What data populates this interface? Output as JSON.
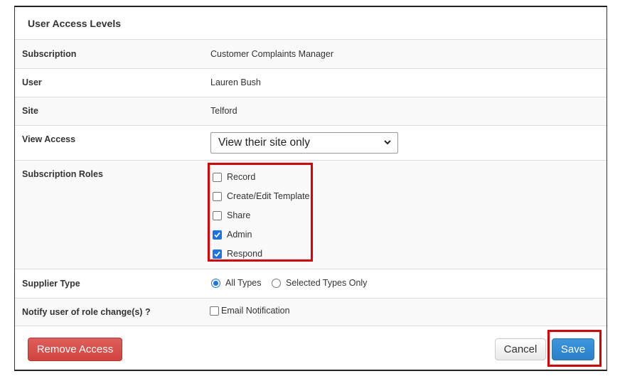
{
  "modal": {
    "title": "User Access Levels"
  },
  "rows": {
    "subscription": {
      "label": "Subscription",
      "value": "Customer Complaints Manager"
    },
    "user": {
      "label": "User",
      "value": "Lauren Bush"
    },
    "site": {
      "label": "Site",
      "value": "Telford"
    },
    "view_access": {
      "label": "View Access",
      "selected": "View their site only"
    },
    "subscription_roles": {
      "label": "Subscription Roles",
      "roles": [
        {
          "label": "Record",
          "checked": false
        },
        {
          "label": "Create/Edit Template",
          "checked": false
        },
        {
          "label": "Share",
          "checked": false
        },
        {
          "label": "Admin",
          "checked": true
        },
        {
          "label": "Respond",
          "checked": true
        }
      ]
    },
    "supplier_type": {
      "label": "Supplier Type",
      "options": [
        {
          "label": "All Types",
          "selected": true
        },
        {
          "label": "Selected Types Only",
          "selected": false
        }
      ]
    },
    "notify": {
      "label": "Notify user of role change(s) ?",
      "checkbox_label": "Email Notification",
      "checked": false
    }
  },
  "footer": {
    "remove_label": "Remove Access",
    "cancel_label": "Cancel",
    "save_label": "Save"
  },
  "colors": {
    "highlight": "#e00000",
    "primary": "#2a7fc9",
    "danger": "#d9534f",
    "checked": "#1a73e8"
  }
}
